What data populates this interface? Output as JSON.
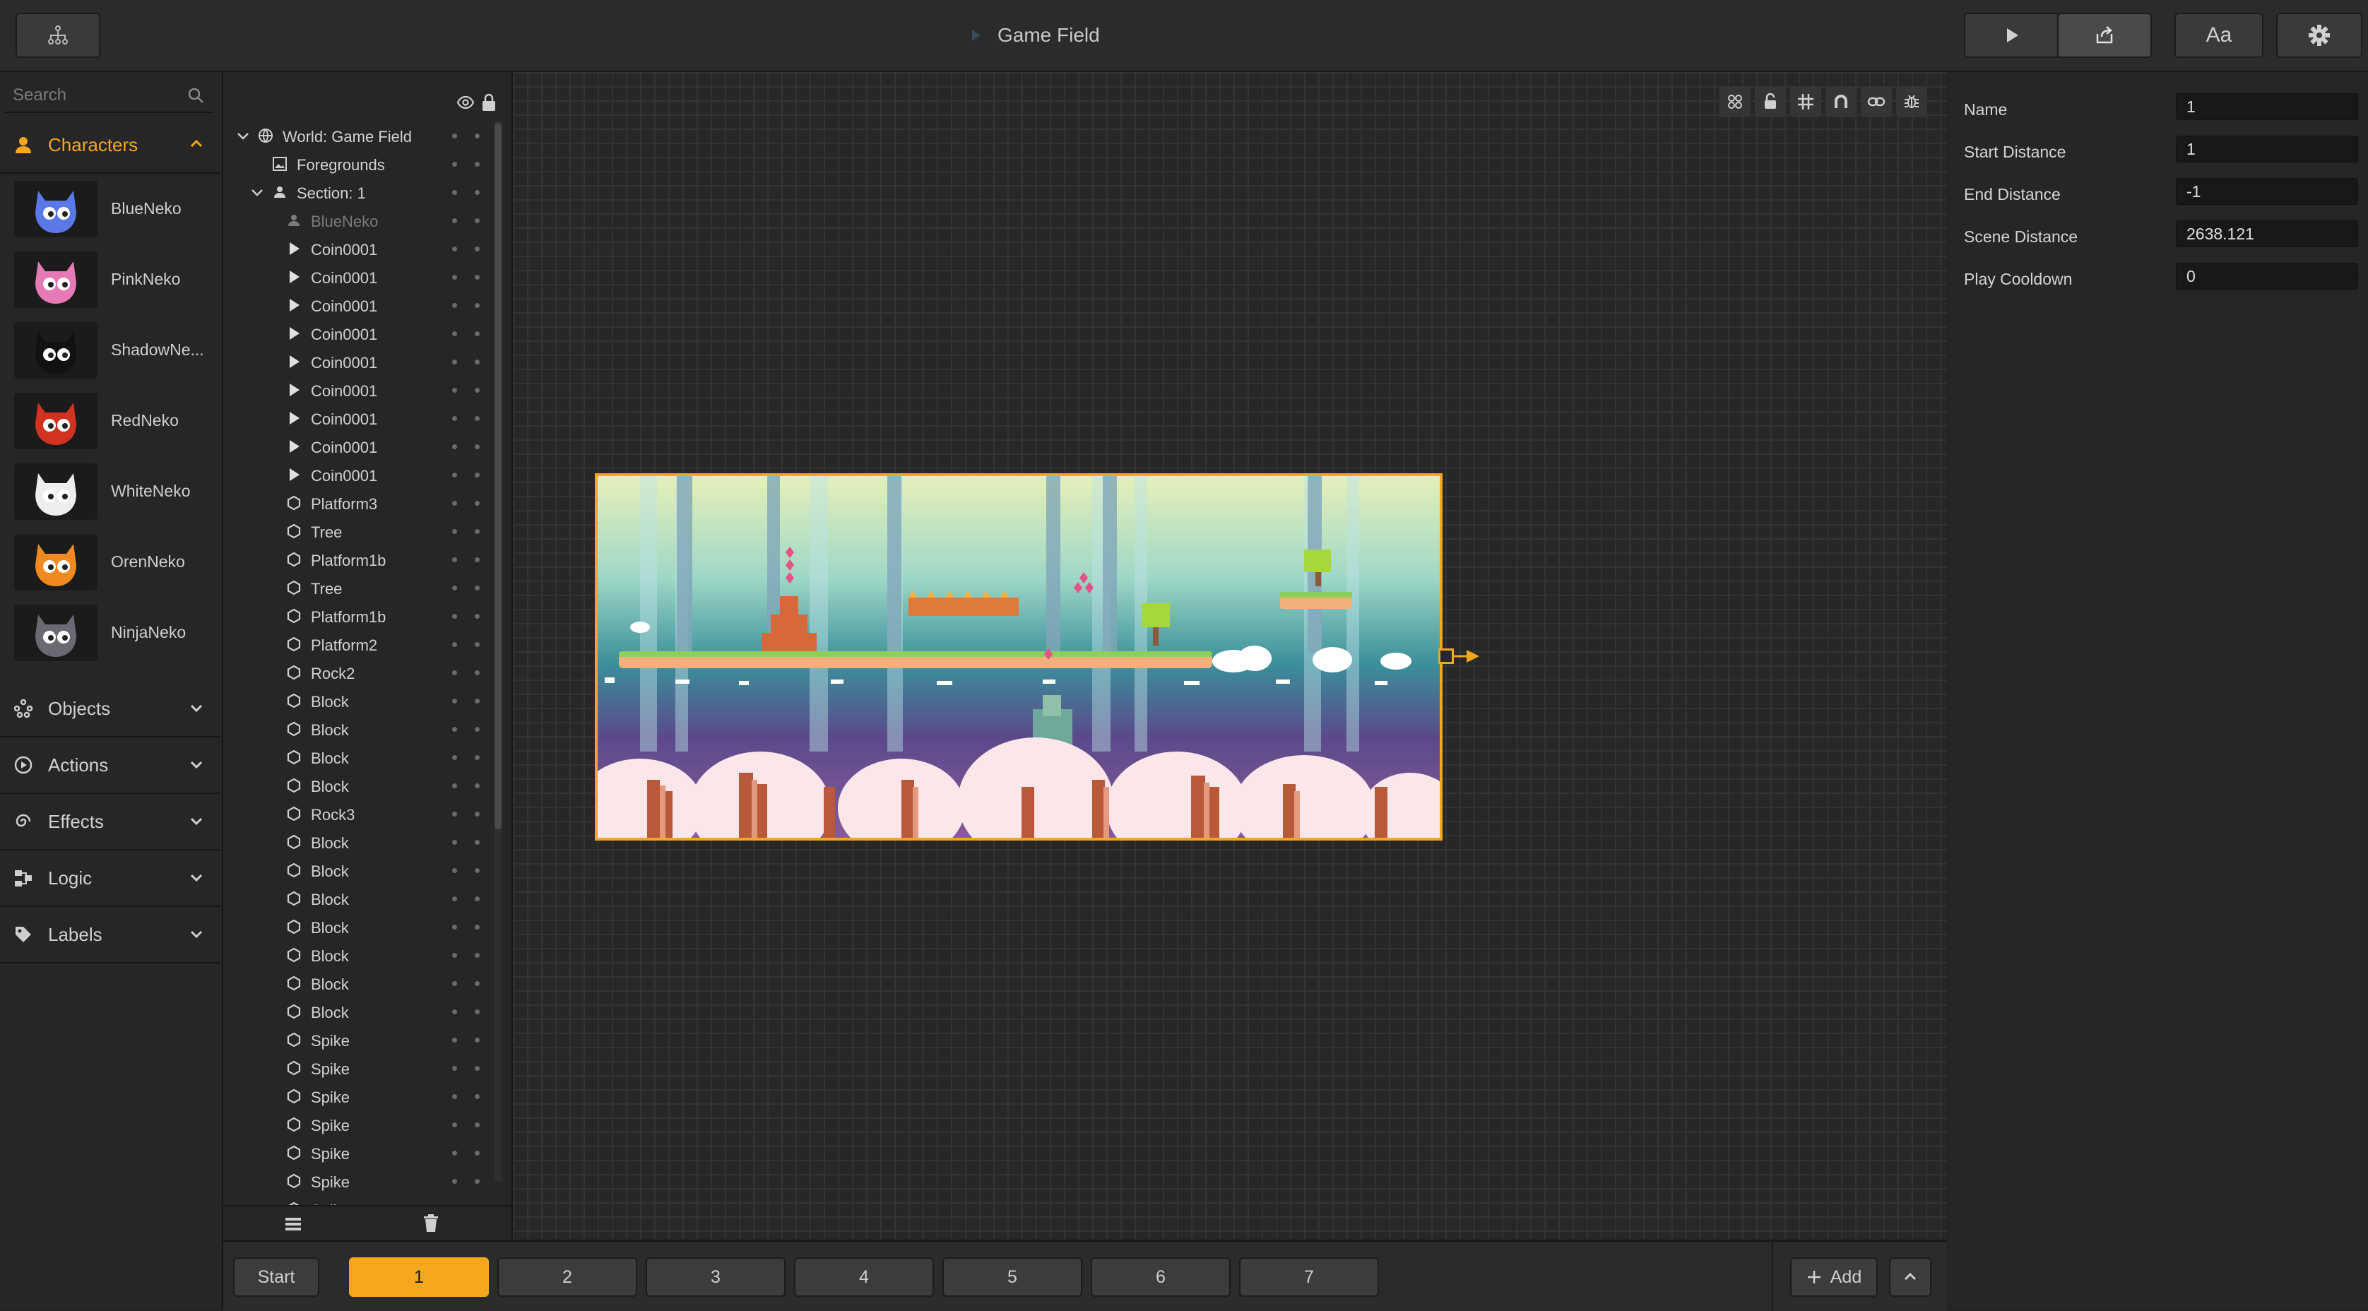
{
  "title": "Game Field",
  "colors": {
    "accent": "#f5a71d",
    "panel": "#262626",
    "canvas": "#272727",
    "grid": "#333333"
  },
  "toolbar": {
    "hierarchy_icon": "hierarchy-icon",
    "play_icon": "play-icon",
    "export_icon": "export-icon",
    "font_label": "Aa",
    "settings_icon": "gear-icon"
  },
  "library": {
    "search_placeholder": "Search",
    "characters_label": "Characters",
    "characters": [
      {
        "name": "BlueNeko",
        "color": "#5a78e6"
      },
      {
        "name": "PinkNeko",
        "color": "#e67ab4"
      },
      {
        "name": "ShadowNe...",
        "color": "#111111"
      },
      {
        "name": "RedNeko",
        "color": "#d23220"
      },
      {
        "name": "WhiteNeko",
        "color": "#eeeeee"
      },
      {
        "name": "OrenNeko",
        "color": "#f08a1e"
      },
      {
        "name": "NinjaNeko",
        "color": "#6a6a72"
      }
    ],
    "categories": [
      {
        "label": "Objects",
        "icon": "objects-icon"
      },
      {
        "label": "Actions",
        "icon": "actions-icon"
      },
      {
        "label": "Effects",
        "icon": "effects-icon"
      },
      {
        "label": "Logic",
        "icon": "logic-icon"
      },
      {
        "label": "Labels",
        "icon": "tag-icon"
      }
    ]
  },
  "hierarchy": {
    "rows": [
      {
        "label": "World: Game Field",
        "icon": "globe",
        "level": 0,
        "expand": "open"
      },
      {
        "label": "Foregrounds",
        "icon": "image",
        "level": 1,
        "expand": ""
      },
      {
        "label": "Section: 1",
        "icon": "person",
        "level": 1,
        "expand": "open"
      },
      {
        "label": "BlueNeko",
        "icon": "person",
        "level": 2,
        "expand": "",
        "dim": true
      },
      {
        "label": "Coin0001",
        "icon": "play",
        "level": 2,
        "expand": ""
      },
      {
        "label": "Coin0001",
        "icon": "play",
        "level": 2,
        "expand": ""
      },
      {
        "label": "Coin0001",
        "icon": "play",
        "level": 2,
        "expand": ""
      },
      {
        "label": "Coin0001",
        "icon": "play",
        "level": 2,
        "expand": ""
      },
      {
        "label": "Coin0001",
        "icon": "play",
        "level": 2,
        "expand": ""
      },
      {
        "label": "Coin0001",
        "icon": "play",
        "level": 2,
        "expand": ""
      },
      {
        "label": "Coin0001",
        "icon": "play",
        "level": 2,
        "expand": ""
      },
      {
        "label": "Coin0001",
        "icon": "play",
        "level": 2,
        "expand": ""
      },
      {
        "label": "Coin0001",
        "icon": "play",
        "level": 2,
        "expand": ""
      },
      {
        "label": "Platform3",
        "icon": "hex",
        "level": 2,
        "expand": ""
      },
      {
        "label": "Tree",
        "icon": "hex",
        "level": 2,
        "expand": ""
      },
      {
        "label": "Platform1b",
        "icon": "hex",
        "level": 2,
        "expand": ""
      },
      {
        "label": "Tree",
        "icon": "hex",
        "level": 2,
        "expand": ""
      },
      {
        "label": "Platform1b",
        "icon": "hex",
        "level": 2,
        "expand": ""
      },
      {
        "label": "Platform2",
        "icon": "hex",
        "level": 2,
        "expand": ""
      },
      {
        "label": "Rock2",
        "icon": "hex",
        "level": 2,
        "expand": ""
      },
      {
        "label": "Block",
        "icon": "hex",
        "level": 2,
        "expand": ""
      },
      {
        "label": "Block",
        "icon": "hex",
        "level": 2,
        "expand": ""
      },
      {
        "label": "Block",
        "icon": "hex",
        "level": 2,
        "expand": ""
      },
      {
        "label": "Block",
        "icon": "hex",
        "level": 2,
        "expand": ""
      },
      {
        "label": "Rock3",
        "icon": "hex",
        "level": 2,
        "expand": ""
      },
      {
        "label": "Block",
        "icon": "hex",
        "level": 2,
        "expand": ""
      },
      {
        "label": "Block",
        "icon": "hex",
        "level": 2,
        "expand": ""
      },
      {
        "label": "Block",
        "icon": "hex",
        "level": 2,
        "expand": ""
      },
      {
        "label": "Block",
        "icon": "hex",
        "level": 2,
        "expand": ""
      },
      {
        "label": "Block",
        "icon": "hex",
        "level": 2,
        "expand": ""
      },
      {
        "label": "Block",
        "icon": "hex",
        "level": 2,
        "expand": ""
      },
      {
        "label": "Block",
        "icon": "hex",
        "level": 2,
        "expand": ""
      },
      {
        "label": "Spike",
        "icon": "hex",
        "level": 2,
        "expand": ""
      },
      {
        "label": "Spike",
        "icon": "hex",
        "level": 2,
        "expand": ""
      },
      {
        "label": "Spike",
        "icon": "hex",
        "level": 2,
        "expand": ""
      },
      {
        "label": "Spike",
        "icon": "hex",
        "level": 2,
        "expand": ""
      },
      {
        "label": "Spike",
        "icon": "hex",
        "level": 2,
        "expand": ""
      },
      {
        "label": "Spike",
        "icon": "hex",
        "level": 2,
        "expand": ""
      },
      {
        "label": "Spike",
        "icon": "hex",
        "level": 2,
        "expand": ""
      }
    ]
  },
  "inspector": {
    "properties": [
      {
        "label": "Name",
        "value": "1"
      },
      {
        "label": "Start Distance",
        "value": "1"
      },
      {
        "label": "End Distance",
        "value": "-1"
      },
      {
        "label": "Scene Distance",
        "value": "2638.121"
      },
      {
        "label": "Play Cooldown",
        "value": "0"
      }
    ]
  },
  "sections": {
    "start_label": "Start",
    "items": [
      "1",
      "2",
      "3",
      "4",
      "5",
      "6",
      "7"
    ],
    "active_index": 0,
    "add_label": "Add"
  }
}
